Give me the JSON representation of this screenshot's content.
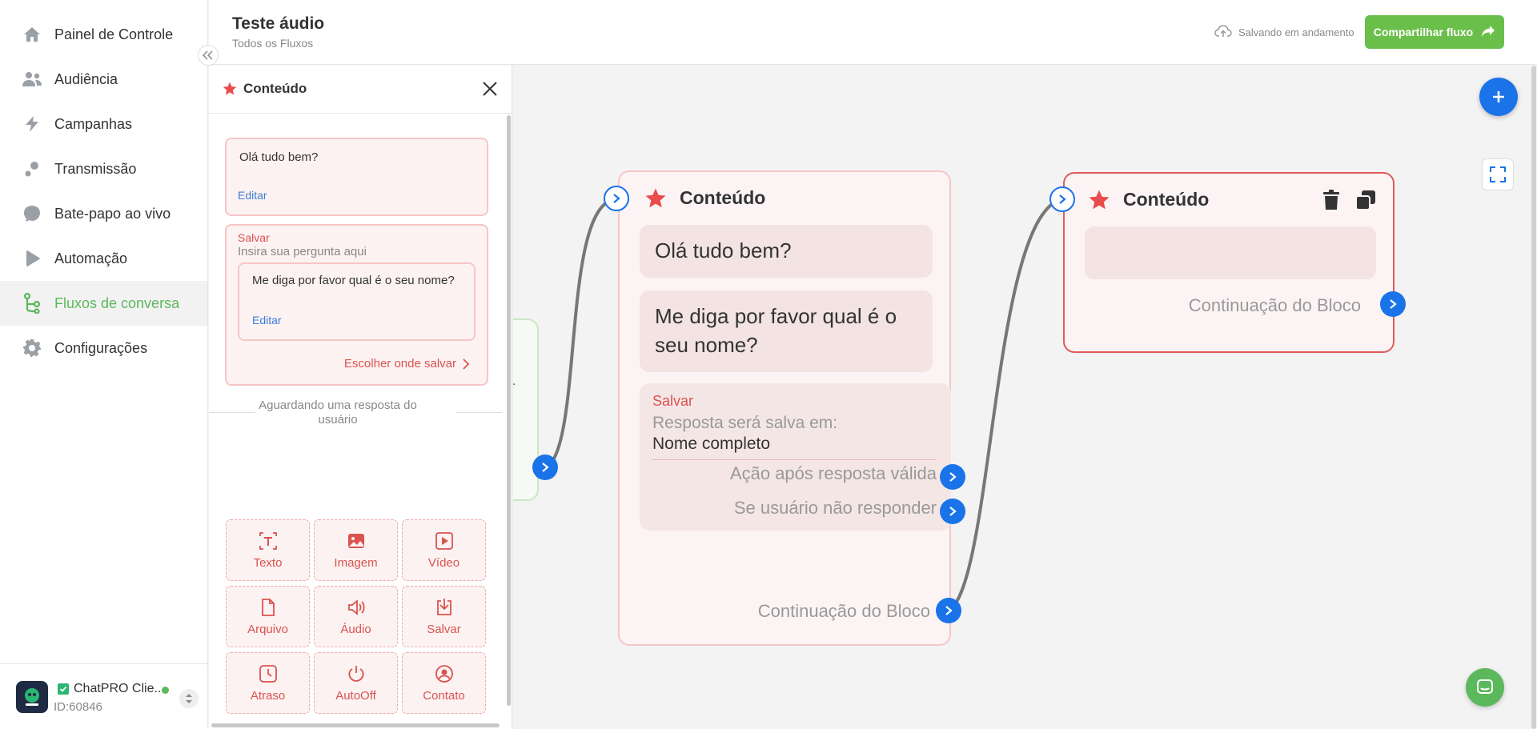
{
  "sidebar": {
    "items": [
      {
        "label": "Painel de Controle",
        "icon": "home-icon",
        "active": false
      },
      {
        "label": "Audiência",
        "icon": "users-icon",
        "active": false
      },
      {
        "label": "Campanhas",
        "icon": "campaign-icon",
        "active": false
      },
      {
        "label": "Transmissão",
        "icon": "broadcast-icon",
        "active": false
      },
      {
        "label": "Bate-papo ao vivo",
        "icon": "chat-bubble-icon",
        "active": false
      },
      {
        "label": "Automação",
        "icon": "play-icon",
        "active": false
      },
      {
        "label": "Fluxos de conversa",
        "icon": "flow-icon",
        "active": true
      },
      {
        "label": "Configurações",
        "icon": "gear-icon",
        "active": false
      }
    ],
    "account": {
      "name": "ChatPRO Clie...",
      "id": "ID:60846",
      "status": "online"
    }
  },
  "header": {
    "title": "Teste áudio",
    "subtitle": "Todos os Fluxos",
    "saving_text": "Salvando em andamento",
    "share_label": "Compartilhar fluxo"
  },
  "panel": {
    "title": "Conteúdo",
    "message": "Olá tudo bem?",
    "edit_label": "Editar",
    "save_label": "Salvar",
    "save_hint": "Insira sua pergunta aqui",
    "question": "Me diga por favor qual é o seu nome?",
    "question_edit_label": "Editar",
    "choose_save": "Escolher onde salvar",
    "waiting": "Aguardando uma resposta do usuário",
    "tools": [
      {
        "label": "Texto",
        "icon": "text-icon"
      },
      {
        "label": "Imagem",
        "icon": "image-icon"
      },
      {
        "label": "Vídeo",
        "icon": "video-icon"
      },
      {
        "label": "Arquivo",
        "icon": "file-icon"
      },
      {
        "label": "Áudio",
        "icon": "audio-icon"
      },
      {
        "label": "Salvar",
        "icon": "save-download-icon"
      },
      {
        "label": "Atraso",
        "icon": "clock-icon"
      },
      {
        "label": "AutoOff",
        "icon": "power-icon"
      },
      {
        "label": "Contato",
        "icon": "contact-icon"
      }
    ]
  },
  "canvas": {
    "partial_node_text": "o.",
    "node1": {
      "title": "Conteúdo",
      "bubble1": "Olá tudo bem?",
      "bubble2": "Me diga por favor qual é o seu nome?",
      "save_label": "Salvar",
      "save_hint": "Resposta será salva em:",
      "save_value": "Nome completo",
      "valid_action": "Ação após resposta válida",
      "no_reply": "Se usuário não responder",
      "continuation": "Continuação do Bloco"
    },
    "node2": {
      "title": "Conteúdo",
      "continuation": "Continuação do Bloco"
    }
  },
  "colors": {
    "accent_green": "#6abf4b",
    "active_nav": "#5cb85c",
    "port_blue": "#1a73e8",
    "brand_red": "#d9534f",
    "star_red": "#e84c4c"
  }
}
